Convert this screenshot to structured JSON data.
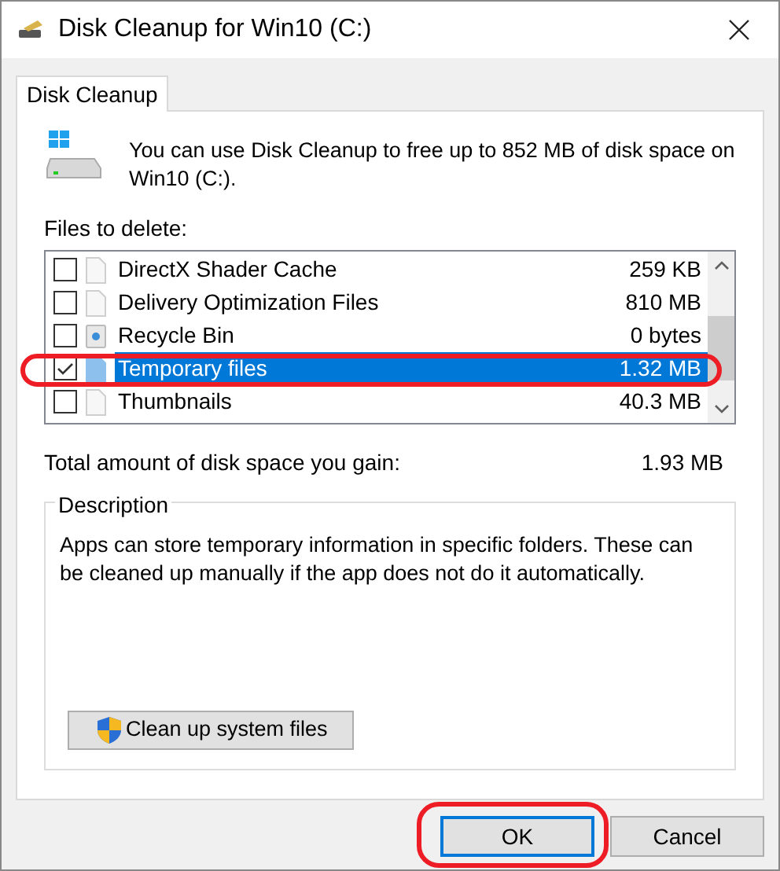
{
  "window": {
    "title": "Disk Cleanup for Win10 (C:)"
  },
  "tabs": [
    {
      "label": "Disk Cleanup",
      "selected": true
    }
  ],
  "intro": "You can use Disk Cleanup to free up to 852 MB of disk space on Win10 (C:).",
  "files_label": "Files to delete:",
  "files": [
    {
      "kind": "file",
      "name": "DirectX Shader Cache",
      "size": "259 KB",
      "checked": false,
      "selected": false
    },
    {
      "kind": "file",
      "name": "Delivery Optimization Files",
      "size": "810 MB",
      "checked": false,
      "selected": false
    },
    {
      "kind": "recycle",
      "name": "Recycle Bin",
      "size": "0 bytes",
      "checked": false,
      "selected": false
    },
    {
      "kind": "file",
      "name": "Temporary files",
      "size": "1.32 MB",
      "checked": true,
      "selected": true
    },
    {
      "kind": "file",
      "name": "Thumbnails",
      "size": "40.3 MB",
      "checked": false,
      "selected": false
    }
  ],
  "total_label": "Total amount of disk space you gain:",
  "total_value": "1.93 MB",
  "description": {
    "title": "Description",
    "text": "Apps can store temporary information in specific folders. These can be cleaned up manually if the app does not do it automatically."
  },
  "cleanup_button": "Clean up system files",
  "buttons": [
    {
      "label": "OK",
      "selected": true
    },
    {
      "label": "Cancel",
      "selected": false
    }
  ]
}
